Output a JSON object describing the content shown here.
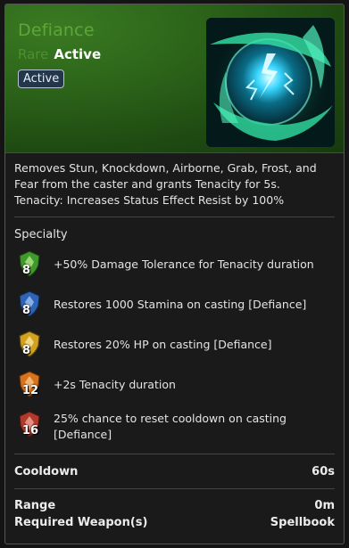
{
  "skill": {
    "name": "Defiance",
    "rarity": "Rare",
    "type": "Active",
    "badge": "Active",
    "icon": "defiance-energy-orb-icon"
  },
  "description": {
    "line1": "Removes Stun, Knockdown, Airborne, Grab, Frost, and",
    "line2": "Fear from the caster and grants Tenacity for 5s.",
    "line3": "Tenacity: Increases Status Effect Resist by 100%"
  },
  "specialty": {
    "title": "Specialty",
    "items": [
      {
        "level": "8",
        "text": "+50% Damage Tolerance for Tenacity duration",
        "icon": "green-shield-icon",
        "color": "#3f9a2c"
      },
      {
        "level": "8",
        "text": "Restores 1000 Stamina on casting [Defiance]",
        "icon": "blue-shield-icon",
        "color": "#2f63b6"
      },
      {
        "level": "8",
        "text": "Restores 20% HP on casting [Defiance]",
        "icon": "yellow-shield-icon",
        "color": "#d1a21f"
      },
      {
        "level": "12",
        "text": "+2s Tenacity duration",
        "icon": "orange-shield-icon",
        "color": "#d8731c"
      },
      {
        "level": "16",
        "text": "25% chance to reset cooldown on casting",
        "text2": "[Defiance]",
        "icon": "red-shield-icon",
        "color": "#b23a2c"
      }
    ]
  },
  "stats": {
    "cooldown_label": "Cooldown",
    "cooldown_value": "60s",
    "range_label": "Range",
    "range_value": "0m",
    "weapon_label": "Required Weapon(s)",
    "weapon_value": "Spellbook"
  }
}
